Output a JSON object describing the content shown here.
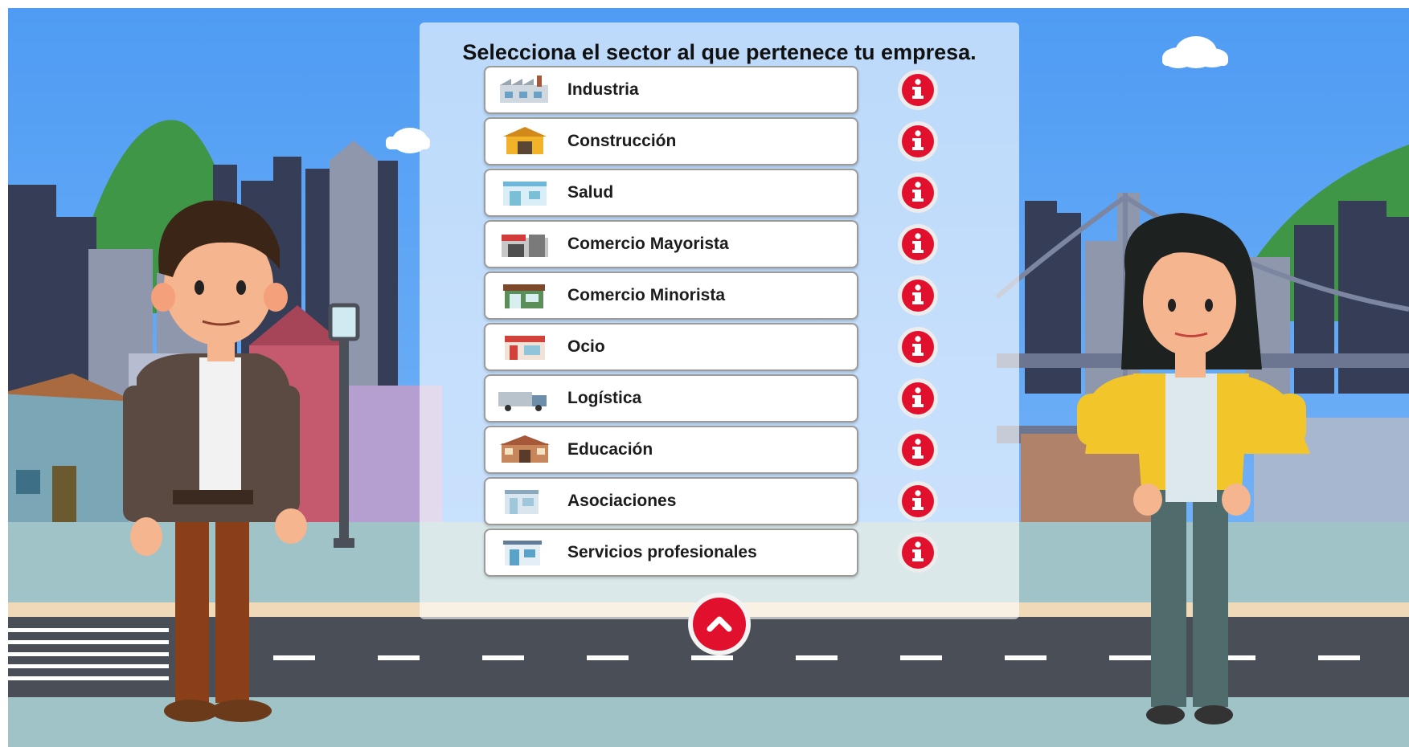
{
  "panel": {
    "title": "Selecciona el sector al que pertenece tu empresa."
  },
  "colors": {
    "accent": "#e1112e",
    "sky": "#54a2f5",
    "road": "#4a4f57"
  },
  "sectors": [
    {
      "label": "Industria",
      "icon": "factory-icon"
    },
    {
      "label": "Construcción",
      "icon": "construction-icon"
    },
    {
      "label": "Salud",
      "icon": "clinic-icon"
    },
    {
      "label": "Comercio Mayorista",
      "icon": "warehouse-icon"
    },
    {
      "label": "Comercio Minorista",
      "icon": "shop-icon"
    },
    {
      "label": "Ocio",
      "icon": "leisure-icon"
    },
    {
      "label": "Logística",
      "icon": "truck-icon"
    },
    {
      "label": "Educación",
      "icon": "school-icon"
    },
    {
      "label": "Asociaciones",
      "icon": "association-icon"
    },
    {
      "label": "Servicios profesionales",
      "icon": "office-icon"
    }
  ],
  "scroll_button": {
    "icon": "chevron-up-icon"
  }
}
